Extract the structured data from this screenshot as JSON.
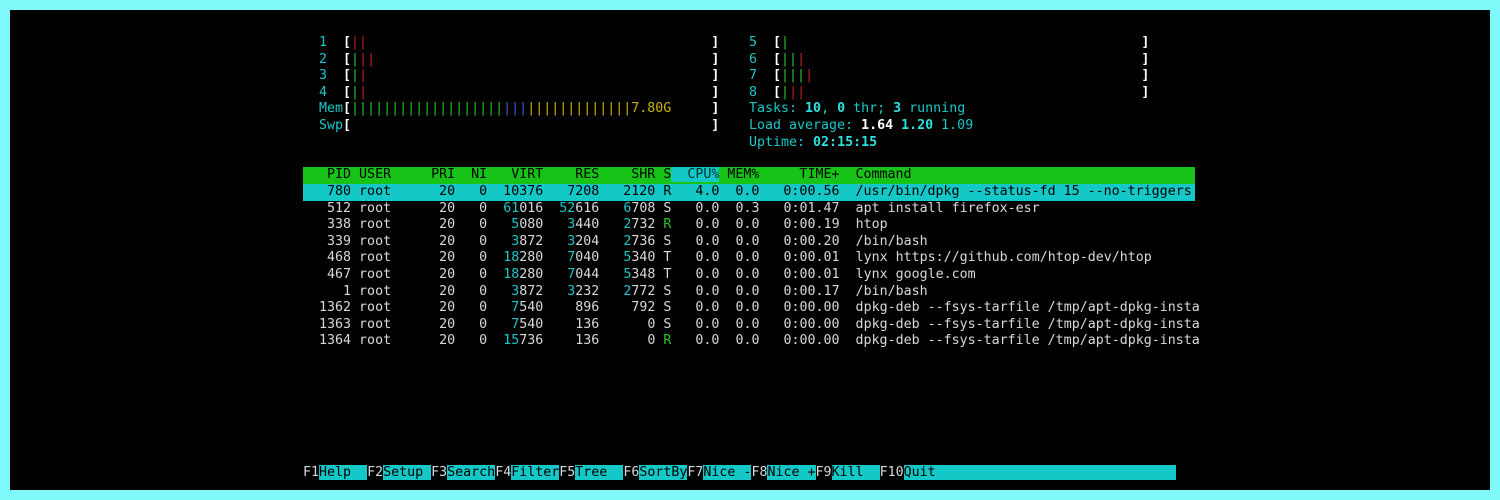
{
  "cpu_meters": [
    {
      "id": "1",
      "open": "[",
      "close": "]",
      "bars": [
        {
          "t": "||",
          "c": "r"
        }
      ]
    },
    {
      "id": "2",
      "open": "[",
      "close": "]",
      "bars": [
        {
          "t": "|",
          "c": "g"
        },
        {
          "t": "||",
          "c": "r"
        }
      ]
    },
    {
      "id": "3",
      "open": "[",
      "close": "]",
      "bars": [
        {
          "t": "|",
          "c": "g"
        },
        {
          "t": "|",
          "c": "r"
        }
      ]
    },
    {
      "id": "4",
      "open": "[",
      "close": "]",
      "bars": [
        {
          "t": "|",
          "c": "g"
        },
        {
          "t": "|",
          "c": "r"
        }
      ]
    },
    {
      "id": "5",
      "open": "[",
      "close": "]",
      "bars": [
        {
          "t": "|",
          "c": "g"
        }
      ]
    },
    {
      "id": "6",
      "open": "[",
      "close": "]",
      "bars": [
        {
          "t": "||",
          "c": "g"
        },
        {
          "t": "|",
          "c": "r"
        }
      ]
    },
    {
      "id": "7",
      "open": "[",
      "close": "]",
      "bars": [
        {
          "t": "|||",
          "c": "g"
        },
        {
          "t": "|",
          "c": "r"
        }
      ]
    },
    {
      "id": "8",
      "open": "[",
      "close": "]",
      "bars": [
        {
          "t": "|",
          "c": "g"
        },
        {
          "t": "||",
          "c": "r"
        }
      ]
    }
  ],
  "mem": {
    "label": "Mem",
    "bars_green": "|||||||||||||||||||",
    "bars_blue": "|||",
    "bars_yellow": "|||||||||||||",
    "value": "7.80G"
  },
  "swp": {
    "label": "Swp"
  },
  "tasks": {
    "label": "Tasks: ",
    "count": "10",
    "sep1": ", ",
    "thr": "0",
    "thr_label": " thr; ",
    "running": "3",
    "running_label": " running"
  },
  "load": {
    "label": "Load average: ",
    "l1": "1.64",
    "l5": "1.20",
    "l15": "1.09"
  },
  "uptime": {
    "label": "Uptime: ",
    "value": "02:15:15"
  },
  "columns": [
    "PID",
    "USER",
    "PRI",
    "NI",
    "VIRT",
    "RES",
    "SHR",
    "S",
    "CPU%",
    "MEM%",
    "TIME+",
    "Command"
  ],
  "processes": [
    {
      "pid": "780",
      "user": "root",
      "pri": "20",
      "ni": "0",
      "virt": "10376",
      "res": "7208",
      "shr": "2120",
      "s": "R",
      "cpu": "4.0",
      "mem": "0.0",
      "time": "0:00.56",
      "cmd": "/usr/bin/dpkg --status-fd 15 --no-triggers",
      "selected": true
    },
    {
      "pid": "512",
      "user": "root",
      "pri": "20",
      "ni": "0",
      "virt": "61016",
      "res": "52616",
      "shr": "6708",
      "s": "S",
      "cpu": "0.0",
      "mem": "0.3",
      "time": "0:01.47",
      "cmd": "apt install firefox-esr"
    },
    {
      "pid": "338",
      "user": "root",
      "pri": "20",
      "ni": "0",
      "virt": "5080",
      "res": "3440",
      "shr": "2732",
      "s": "R",
      "cpu": "0.0",
      "mem": "0.0",
      "time": "0:00.19",
      "cmd": "htop"
    },
    {
      "pid": "339",
      "user": "root",
      "pri": "20",
      "ni": "0",
      "virt": "3872",
      "res": "3204",
      "shr": "2736",
      "s": "S",
      "cpu": "0.0",
      "mem": "0.0",
      "time": "0:00.20",
      "cmd": "/bin/bash"
    },
    {
      "pid": "468",
      "user": "root",
      "pri": "20",
      "ni": "0",
      "virt": "18280",
      "res": "7040",
      "shr": "5340",
      "s": "T",
      "cpu": "0.0",
      "mem": "0.0",
      "time": "0:00.01",
      "cmd": "lynx https://github.com/htop-dev/htop"
    },
    {
      "pid": "467",
      "user": "root",
      "pri": "20",
      "ni": "0",
      "virt": "18280",
      "res": "7044",
      "shr": "5348",
      "s": "T",
      "cpu": "0.0",
      "mem": "0.0",
      "time": "0:00.01",
      "cmd": "lynx google.com"
    },
    {
      "pid": "1",
      "user": "root",
      "pri": "20",
      "ni": "0",
      "virt": "3872",
      "res": "3232",
      "shr": "2772",
      "s": "S",
      "cpu": "0.0",
      "mem": "0.0",
      "time": "0:00.17",
      "cmd": "/bin/bash"
    },
    {
      "pid": "1362",
      "user": "root",
      "pri": "20",
      "ni": "0",
      "virt": "7540",
      "res": "896",
      "shr": "792",
      "s": "S",
      "cpu": "0.0",
      "mem": "0.0",
      "time": "0:00.00",
      "cmd": "dpkg-deb --fsys-tarfile /tmp/apt-dpkg-insta"
    },
    {
      "pid": "1363",
      "user": "root",
      "pri": "20",
      "ni": "0",
      "virt": "7540",
      "res": "136",
      "shr": "0",
      "s": "S",
      "cpu": "0.0",
      "mem": "0.0",
      "time": "0:00.00",
      "cmd": "dpkg-deb --fsys-tarfile /tmp/apt-dpkg-insta"
    },
    {
      "pid": "1364",
      "user": "root",
      "pri": "20",
      "ni": "0",
      "virt": "15736",
      "res": "136",
      "shr": "0",
      "s": "R",
      "cpu": "0.0",
      "mem": "0.0",
      "time": "0:00.00",
      "cmd": "dpkg-deb --fsys-tarfile /tmp/apt-dpkg-insta"
    }
  ],
  "function_keys": [
    {
      "key": "F1",
      "label": "Help  "
    },
    {
      "key": "F2",
      "label": "Setup "
    },
    {
      "key": "F3",
      "label": "Search"
    },
    {
      "key": "F4",
      "label": "Filter"
    },
    {
      "key": "F5",
      "label": "Tree  "
    },
    {
      "key": "F6",
      "label": "SortBy"
    },
    {
      "key": "F7",
      "label": "Nice -"
    },
    {
      "key": "F8",
      "label": "Nice +"
    },
    {
      "key": "F9",
      "label": "Kill  "
    },
    {
      "key": "F10",
      "label": "Quit"
    }
  ],
  "colors": {
    "terminal_bg": "#000000",
    "frame": "#7ff9f9",
    "header_bar": "#17c317",
    "selection": "#14c8c8",
    "cyan_text": "#1ac8c8"
  }
}
